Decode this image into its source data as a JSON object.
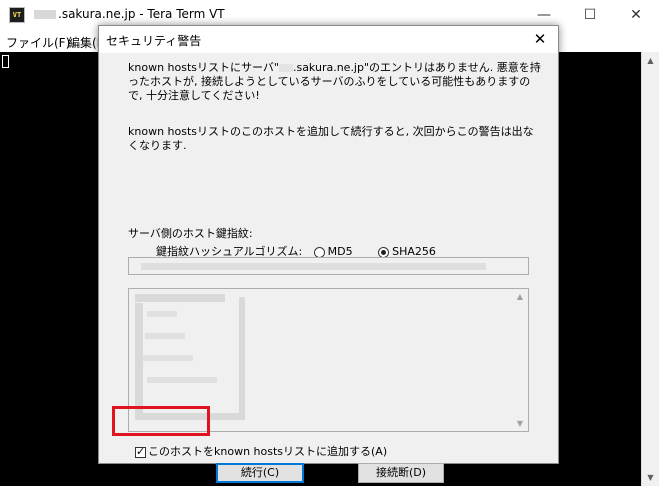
{
  "main_window": {
    "title": ".sakura.ne.jp - Tera Term VT",
    "app_icon_text": "VT",
    "menu": [
      "ファイル(F)",
      "編集(E"
    ]
  },
  "dialog": {
    "title": "セキュリティ警告",
    "close_glyph": "✕",
    "message1_line1_pre": "known hostsリストにサーバ\"",
    "message1_line1_post": ".sakura.ne.jp\"のエントリはありません. 悪意を持",
    "message1_line2": "ったホストが, 接続しようとしているサーバのふりをしている可能性もありますの",
    "message1_line3": "で, 十分注意してください!",
    "message2_line1": "known hostsリストのこのホストを追加して続行すると, 次回からこの警告は出な",
    "message2_line2": "くなります.",
    "fingerprint_label": "サーバ側のホスト鍵指紋:",
    "hash_label": "鍵指紋ハッシュアルゴリズム:",
    "hash_options": [
      {
        "label": "MD5",
        "selected": false
      },
      {
        "label": "SHA256",
        "selected": true
      }
    ],
    "add_to_known_hosts": {
      "label": "このホストをknown hostsリストに追加する(A)",
      "checked": true
    },
    "continue_button": "続行(C)",
    "disconnect_button": "接続断(D)"
  },
  "colors": {
    "highlight": "#e0141e",
    "default_button_border": "#0078d7"
  }
}
